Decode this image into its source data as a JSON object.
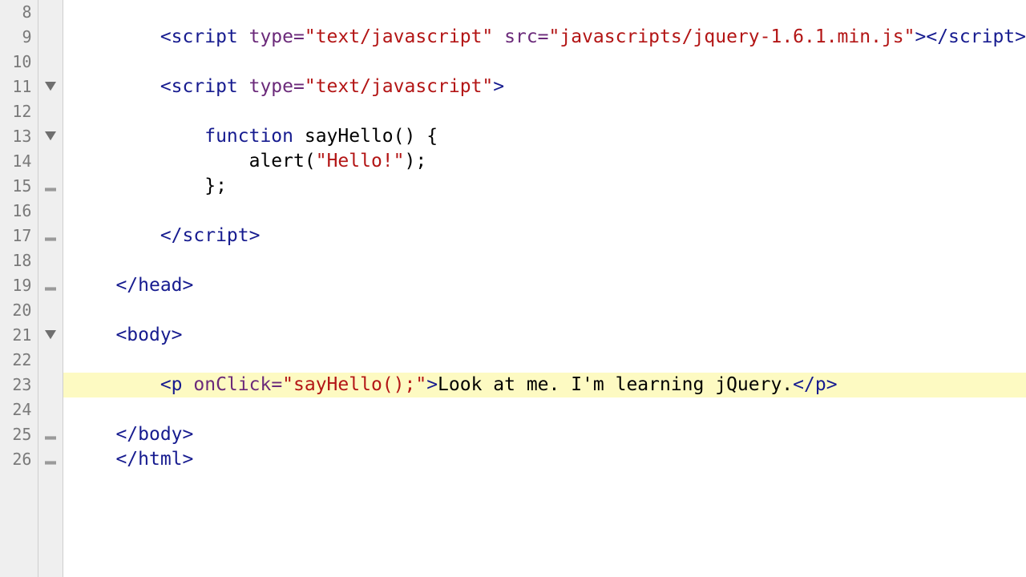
{
  "gutter": {
    "line_numbers": [
      "8",
      "9",
      "10",
      "11",
      "12",
      "13",
      "14",
      "15",
      "16",
      "17",
      "18",
      "19",
      "20",
      "21",
      "22",
      "23",
      "24",
      "25",
      "26"
    ],
    "fold_markers": {
      "11": "open",
      "13": "open",
      "15": "end",
      "17": "end",
      "19": "end",
      "21": "open",
      "25": "end",
      "26": "end"
    }
  },
  "highlighted_line": "23",
  "code": {
    "l8": "",
    "l9": {
      "indent": "        ",
      "tag_open": "<script ",
      "attr1_name": "type",
      "attr1_val": "\"text/javascript\"",
      "space1": " ",
      "attr2_name": "src",
      "attr2_val": "\"javascripts/jquery-1.6.1.min.js\"",
      "tag_close_open": ">",
      "tag_close": "</scr",
      "tag_close2": "ipt>"
    },
    "l10": "",
    "l11": {
      "indent": "        ",
      "tag_open": "<script ",
      "attr1_name": "type",
      "attr1_val": "\"text/javascript\"",
      "tag_close": ">"
    },
    "l12": "",
    "l13": {
      "indent": "            ",
      "kw": "function",
      "space": " ",
      "name": "sayHello",
      "paren": "()",
      "space2": " ",
      "brace": "{"
    },
    "l14": {
      "indent": "                ",
      "call": "alert",
      "paren_open": "(",
      "str": "\"Hello!\"",
      "paren_close": ")",
      "semi": ";"
    },
    "l15": {
      "indent": "            ",
      "brace": "}",
      "semi": ";"
    },
    "l16": "",
    "l17": {
      "indent": "        ",
      "tag": "</scr",
      "tag2": "ipt>"
    },
    "l18": "",
    "l19": {
      "indent": "    ",
      "tag": "</head>"
    },
    "l20": "",
    "l21": {
      "indent": "    ",
      "tag": "<body>"
    },
    "l22": "",
    "l23": {
      "indent": "        ",
      "tag_open": "<p ",
      "attr_name": "onClick",
      "attr_val": "\"sayHello();\"",
      "tag_mid": ">",
      "text": "Look at me. I'm learning jQuery.",
      "tag_close": "</p>"
    },
    "l24": "",
    "l25": {
      "indent": "    ",
      "tag": "</body>"
    },
    "l26": {
      "indent": "    ",
      "tag": "</html>"
    }
  }
}
